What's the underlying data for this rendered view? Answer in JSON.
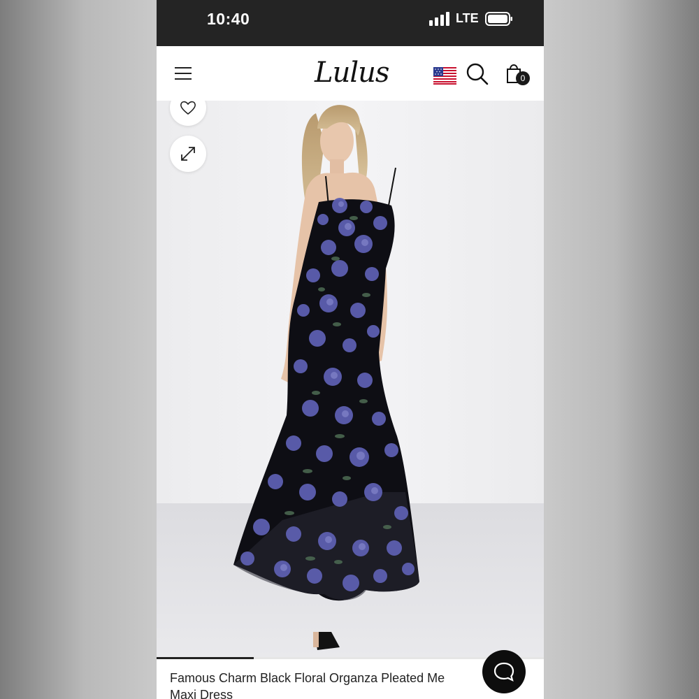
{
  "status_bar": {
    "time": "10:40",
    "carrier": "LTE",
    "icons": [
      "signal-icon",
      "battery-icon"
    ]
  },
  "header": {
    "logo_text": "Lulus",
    "icons": [
      "menu-icon",
      "us-flag-icon",
      "search-icon",
      "shopping-bag-icon"
    ],
    "cart_count": "0"
  },
  "gallery": {
    "buttons": [
      "heart-icon",
      "expand-icon"
    ],
    "image_progress": 0.25
  },
  "product": {
    "title_line1": "Famous Charm Black Floral Organza Pleated Me",
    "title_line2": "Maxi Dress"
  },
  "chat": {
    "icon": "chat-icon"
  },
  "colors": {
    "status_bg": "#242424",
    "header_bg": "#ffffff",
    "dress_black": "#0e0e14",
    "flower_blue": "#5d5fb0",
    "leaf_green": "#4d6b53",
    "chat_bg": "#0d0d0d"
  }
}
